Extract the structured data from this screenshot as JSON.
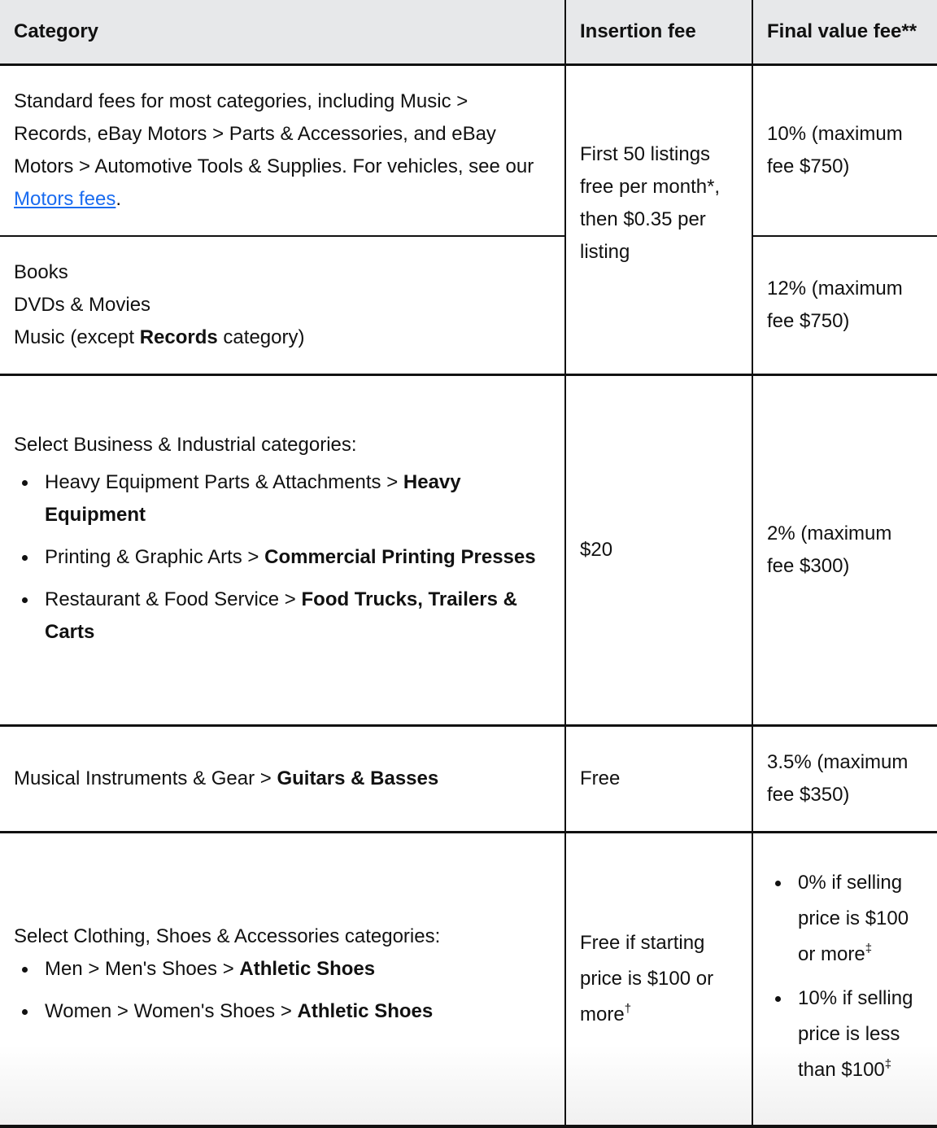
{
  "table": {
    "headers": {
      "category": "Category",
      "insertion_fee": "Insertion fee",
      "final_value_fee": "Final value fee**"
    },
    "colors": {
      "header_bg": "#e7e8ea",
      "link": "#1a6cf0",
      "border": "#111111"
    },
    "rows": [
      {
        "category": {
          "text": "Standard fees for most categories, including Music > Records, eBay Motors > Parts & Accessories, and eBay Motors > Automotive Tools & Supplies. For vehicles, see our ",
          "link_text": "Motors fees",
          "trailing": "."
        },
        "final_value_fee": "10% (maximum fee $750)"
      },
      {
        "category_lines": [
          "Books",
          "DVDs & Movies"
        ],
        "category_music": {
          "prefix": "Music (except ",
          "bold": "Records",
          "suffix": " category)"
        },
        "final_value_fee": "12% (maximum fee $750)"
      },
      {
        "category_intro": "Select Business & Industrial categories:",
        "items": [
          {
            "path": "Heavy Equipment Parts & Attachments > ",
            "bold": "Heavy Equipment"
          },
          {
            "path": "Printing & Graphic Arts > ",
            "bold": "Commercial Printing Presses"
          },
          {
            "path": "Restaurant & Food Service > ",
            "bold": "Food Trucks, Trailers & Carts"
          }
        ],
        "insertion_fee": "$20",
        "final_value_fee": "2% (maximum fee $300)"
      },
      {
        "category_path": "Musical Instruments & Gear > ",
        "category_bold": "Guitars & Basses",
        "insertion_fee": "Free",
        "final_value_fee": "3.5% (maximum fee $350)"
      },
      {
        "category_intro": "Select Clothing, Shoes & Accessories categories:",
        "items": [
          {
            "path": "Men > Men's Shoes > ",
            "bold": "Athletic Shoes"
          },
          {
            "path": "Women > Women's Shoes > ",
            "bold": "Athletic Shoes"
          }
        ],
        "insertion_fee": "Free if starting price is $100 or more",
        "insertion_fee_mark": "†",
        "final_value_items": [
          {
            "text": "0% if selling price is $100 or more",
            "mark": "‡"
          },
          {
            "text": "10% if selling price is less than $100",
            "mark": "‡"
          }
        ]
      }
    ],
    "shared_insertion_fee": "First 50 listings free per month*, then $0.35 per listing"
  }
}
